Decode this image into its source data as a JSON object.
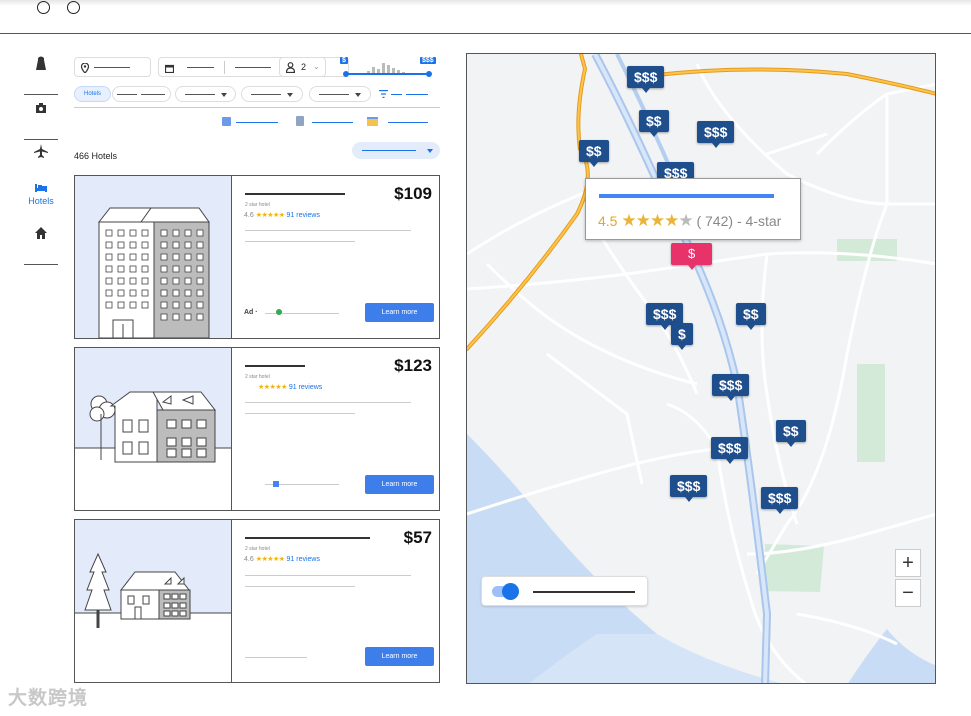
{
  "guests": "2",
  "price_filter": {
    "min_label": "$",
    "max_label": "$$$"
  },
  "filters": {
    "active_chip": "Hotels"
  },
  "results_count": "466 Hotels",
  "rail": {
    "hotels_label": "Hotels"
  },
  "hotels": [
    {
      "price": "$109",
      "subtitle": "2 star hotel",
      "rating": "4.6",
      "stars": "★★★★★",
      "reviews": "91 reviews",
      "ad": "Ad ·",
      "cta": "Learn more"
    },
    {
      "price": "$123",
      "subtitle": "2 star hotel",
      "rating": "",
      "stars": "★★★★★",
      "reviews": "91 reviews",
      "cta": "Learn more"
    },
    {
      "price": "$57",
      "subtitle": "2 star hotel",
      "rating": "4.6",
      "stars": "★★★★★",
      "reviews": "91 reviews",
      "cta": "Learn more"
    }
  ],
  "map": {
    "pins": [
      "$$$",
      "$$",
      "$$$",
      "$$",
      "$$$",
      "$",
      "$$$",
      "$",
      "$$",
      "$$$",
      "$$$",
      "$$",
      "$$$",
      "$$$"
    ],
    "tooltip": {
      "rating": "4.5",
      "stars_on": "★★★★",
      "stars_off": "★",
      "reviews": "( 742)",
      "suffix": "- 4-star"
    },
    "zoom_in": "+",
    "zoom_out": "−"
  },
  "colors": {
    "accent": "#1a73e8",
    "pin": "#1f4e8c",
    "pin_selected": "#e8336a",
    "button": "#3d7eea"
  },
  "watermark": "大数跨境"
}
